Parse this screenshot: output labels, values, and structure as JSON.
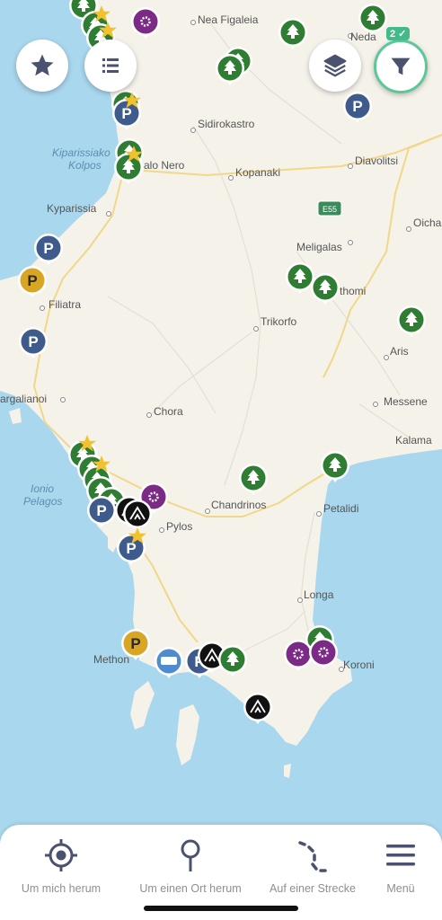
{
  "map": {
    "places": [
      {
        "id": "nea-figaleia",
        "name": "Nea Figaleia"
      },
      {
        "id": "neda",
        "name": "Neda"
      },
      {
        "id": "sidirokastro",
        "name": "Sidirokastro"
      },
      {
        "id": "diavolitsi",
        "name": "Diavolitsi"
      },
      {
        "id": "kalo-nero",
        "name": "alo Nero"
      },
      {
        "id": "kopanaki",
        "name": "Kopanaki"
      },
      {
        "id": "kyparissia",
        "name": "Kyparissia"
      },
      {
        "id": "oichalia",
        "name": "Oicha"
      },
      {
        "id": "meligalas",
        "name": "Meligalas"
      },
      {
        "id": "filiatra",
        "name": "Filiatra"
      },
      {
        "id": "ithomi",
        "name": "thomi"
      },
      {
        "id": "trikorfo",
        "name": "Trikorfo"
      },
      {
        "id": "aris",
        "name": "Aris"
      },
      {
        "id": "gargalianoi",
        "name": "argalianoi"
      },
      {
        "id": "chora",
        "name": "Chora"
      },
      {
        "id": "messene",
        "name": "Messene"
      },
      {
        "id": "kalamata",
        "name": "Kalama"
      },
      {
        "id": "chandrinos",
        "name": "Chandrinos"
      },
      {
        "id": "petalidi",
        "name": "Petalidi"
      },
      {
        "id": "pylos",
        "name": "Pylos"
      },
      {
        "id": "longa",
        "name": "Longa"
      },
      {
        "id": "methoni",
        "name": "Methon"
      },
      {
        "id": "koroni",
        "name": "Koroni"
      }
    ],
    "water_labels": [
      {
        "id": "kyparissiakos",
        "lines": [
          "Kiparissiako",
          "Kolpos"
        ]
      },
      {
        "id": "ionio",
        "lines": [
          "Ionio",
          "Pelagos"
        ]
      }
    ],
    "road_badge": "E55",
    "colors": {
      "sea": "#a9d7ee",
      "land": "#f5f2ea",
      "forest": "#2e7d32",
      "parking": "#3e5b8c",
      "parking_gold": "#d8a524",
      "service": "#7b2a86",
      "camping": "#111111",
      "camper": "#4f8ccf",
      "star": "#f2c12e"
    }
  },
  "controls": {
    "favorites_icon": "star-icon",
    "list_icon": "list-icon",
    "layers_icon": "layers-icon",
    "filter_icon": "funnel-icon",
    "filter_count": "2 ✓"
  },
  "bottom_nav": {
    "items": [
      {
        "label": "Um mich herum",
        "icon": "crosshair-icon"
      },
      {
        "label": "Um einen Ort herum",
        "icon": "pin-search-icon"
      },
      {
        "label": "Auf einer Strecke",
        "icon": "route-icon"
      },
      {
        "label": "Menü",
        "icon": "menu-icon"
      }
    ]
  }
}
